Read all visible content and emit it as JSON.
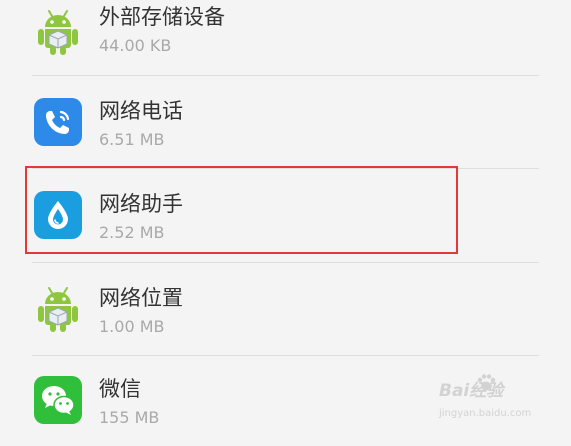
{
  "apps": [
    {
      "name": "外部存储设备",
      "size": "44.00 KB",
      "icon": "android-robot-icon"
    },
    {
      "name": "网络电话",
      "size": "6.51 MB",
      "icon": "phone-call-icon"
    },
    {
      "name": "网络助手",
      "size": "2.52 MB",
      "icon": "water-drop-icon",
      "highlighted": true
    },
    {
      "name": "网络位置",
      "size": "1.00 MB",
      "icon": "android-robot-icon"
    },
    {
      "name": "微信",
      "size": "155 MB",
      "icon": "wechat-icon"
    }
  ],
  "colors": {
    "background": "#f4f4f4",
    "highlight_border": "#e53935",
    "android_green": "#8ec63f",
    "phone_blue": "#2d8ae8",
    "drop_blue": "#1a9ee0",
    "wechat_green": "#2fbf3a"
  },
  "watermark": {
    "logo": "Bai经验",
    "url": "jingyan.baidu.com"
  }
}
